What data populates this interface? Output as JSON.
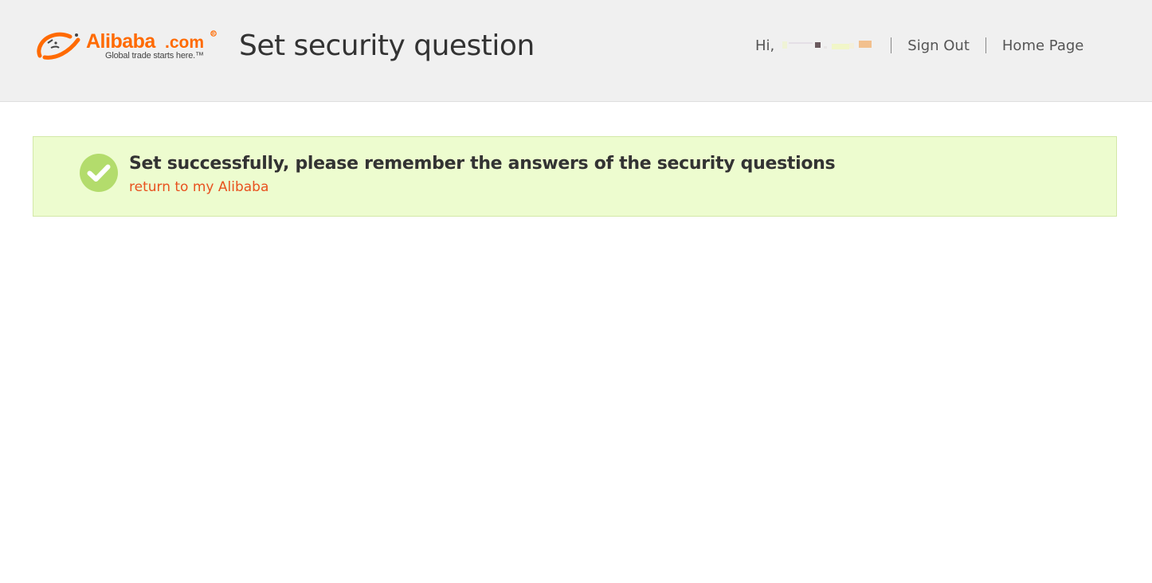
{
  "header": {
    "logo": {
      "brand": "Alibaba.com",
      "tagline": "Global trade starts here.™",
      "brand_color": "#ff6a00"
    },
    "title": "Set security question",
    "user_nav": {
      "greeting": "Hi,",
      "sign_out_label": "Sign Out",
      "home_page_label": "Home Page"
    }
  },
  "notice": {
    "icon": "check-circle-icon",
    "icon_color": "#b3dc6c",
    "message": "Set successfully, please remember the answers of the security questions",
    "return_link_label": "return to my Alibaba",
    "link_color": "#e8511e",
    "background_color": "#edfccf"
  }
}
